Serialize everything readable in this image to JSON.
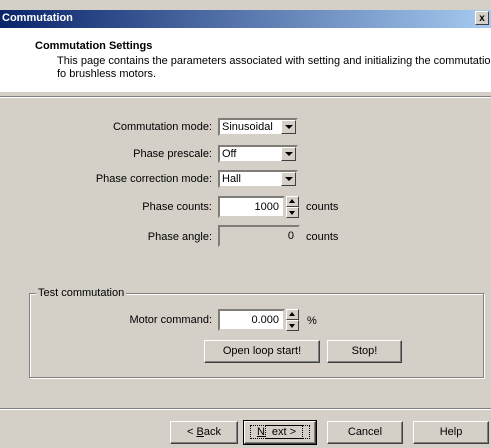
{
  "window": {
    "title": "Commutation",
    "close_glyph": "x"
  },
  "header": {
    "title": "Commutation Settings",
    "description": "This page contains the parameters associated with setting and initializing the commutation fo brushless motors."
  },
  "fields": {
    "commutation_mode": {
      "label": "Commutation mode:",
      "value": "Sinusoidal"
    },
    "phase_prescale": {
      "label": "Phase prescale:",
      "value": "Off"
    },
    "phase_correction_mode": {
      "label": "Phase correction mode:",
      "value": "Hall"
    },
    "phase_counts": {
      "label": "Phase counts:",
      "value": "1000",
      "unit": "counts"
    },
    "phase_angle": {
      "label": "Phase angle:",
      "value": "0",
      "unit": "counts"
    }
  },
  "test": {
    "group_label": "Test commutation",
    "motor_command": {
      "label": "Motor command:",
      "value": "0.000",
      "unit": "%"
    },
    "open_loop_start": "Open loop start!",
    "stop": "Stop!"
  },
  "footer": {
    "back_pre": "< ",
    "back_key": "B",
    "back_post": "ack",
    "next_key": "N",
    "next_post": "ext >",
    "cancel": "Cancel",
    "help": "Help"
  }
}
